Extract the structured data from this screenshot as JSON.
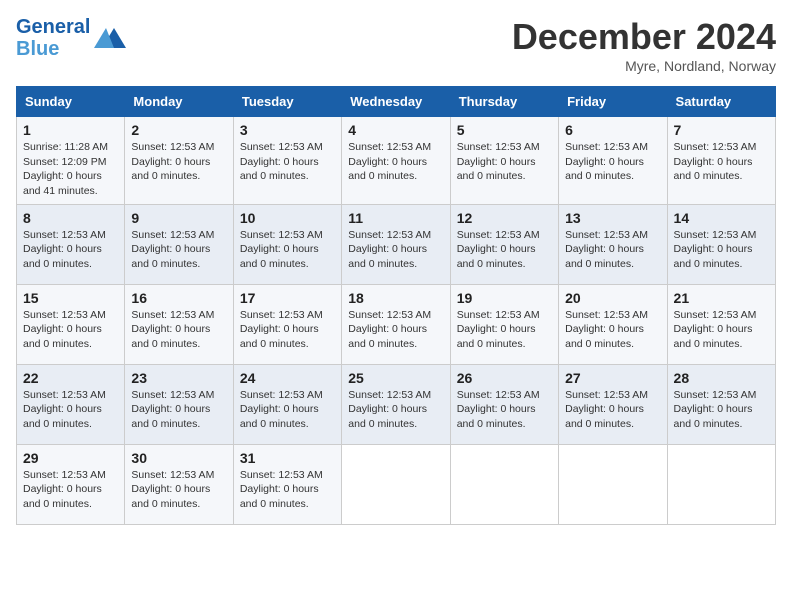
{
  "logo": {
    "line1": "General",
    "line2": "Blue"
  },
  "title": "December 2024",
  "subtitle": "Myre, Nordland, Norway",
  "days_of_week": [
    "Sunday",
    "Monday",
    "Tuesday",
    "Wednesday",
    "Thursday",
    "Friday",
    "Saturday"
  ],
  "weeks": [
    [
      {
        "num": "1",
        "info": "Sunrise: 11:28 AM\nSunset: 12:09 PM\nDaylight: 0 hours\nand 41 minutes."
      },
      {
        "num": "2",
        "info": "Sunset: 12:53 AM\nDaylight: 0 hours\nand 0 minutes."
      },
      {
        "num": "3",
        "info": "Sunset: 12:53 AM\nDaylight: 0 hours\nand 0 minutes."
      },
      {
        "num": "4",
        "info": "Sunset: 12:53 AM\nDaylight: 0 hours\nand 0 minutes."
      },
      {
        "num": "5",
        "info": "Sunset: 12:53 AM\nDaylight: 0 hours\nand 0 minutes."
      },
      {
        "num": "6",
        "info": "Sunset: 12:53 AM\nDaylight: 0 hours\nand 0 minutes."
      },
      {
        "num": "7",
        "info": "Sunset: 12:53 AM\nDaylight: 0 hours\nand 0 minutes."
      }
    ],
    [
      {
        "num": "8",
        "info": "Sunset: 12:53 AM\nDaylight: 0 hours\nand 0 minutes."
      },
      {
        "num": "9",
        "info": "Sunset: 12:53 AM\nDaylight: 0 hours\nand 0 minutes."
      },
      {
        "num": "10",
        "info": "Sunset: 12:53 AM\nDaylight: 0 hours\nand 0 minutes."
      },
      {
        "num": "11",
        "info": "Sunset: 12:53 AM\nDaylight: 0 hours\nand 0 minutes."
      },
      {
        "num": "12",
        "info": "Sunset: 12:53 AM\nDaylight: 0 hours\nand 0 minutes."
      },
      {
        "num": "13",
        "info": "Sunset: 12:53 AM\nDaylight: 0 hours\nand 0 minutes."
      },
      {
        "num": "14",
        "info": "Sunset: 12:53 AM\nDaylight: 0 hours\nand 0 minutes."
      }
    ],
    [
      {
        "num": "15",
        "info": "Sunset: 12:53 AM\nDaylight: 0 hours\nand 0 minutes."
      },
      {
        "num": "16",
        "info": "Sunset: 12:53 AM\nDaylight: 0 hours\nand 0 minutes."
      },
      {
        "num": "17",
        "info": "Sunset: 12:53 AM\nDaylight: 0 hours\nand 0 minutes."
      },
      {
        "num": "18",
        "info": "Sunset: 12:53 AM\nDaylight: 0 hours\nand 0 minutes."
      },
      {
        "num": "19",
        "info": "Sunset: 12:53 AM\nDaylight: 0 hours\nand 0 minutes."
      },
      {
        "num": "20",
        "info": "Sunset: 12:53 AM\nDaylight: 0 hours\nand 0 minutes."
      },
      {
        "num": "21",
        "info": "Sunset: 12:53 AM\nDaylight: 0 hours\nand 0 minutes."
      }
    ],
    [
      {
        "num": "22",
        "info": "Sunset: 12:53 AM\nDaylight: 0 hours\nand 0 minutes."
      },
      {
        "num": "23",
        "info": "Sunset: 12:53 AM\nDaylight: 0 hours\nand 0 minutes."
      },
      {
        "num": "24",
        "info": "Sunset: 12:53 AM\nDaylight: 0 hours\nand 0 minutes."
      },
      {
        "num": "25",
        "info": "Sunset: 12:53 AM\nDaylight: 0 hours\nand 0 minutes."
      },
      {
        "num": "26",
        "info": "Sunset: 12:53 AM\nDaylight: 0 hours\nand 0 minutes."
      },
      {
        "num": "27",
        "info": "Sunset: 12:53 AM\nDaylight: 0 hours\nand 0 minutes."
      },
      {
        "num": "28",
        "info": "Sunset: 12:53 AM\nDaylight: 0 hours\nand 0 minutes."
      }
    ],
    [
      {
        "num": "29",
        "info": "Sunset: 12:53 AM\nDaylight: 0 hours\nand 0 minutes."
      },
      {
        "num": "30",
        "info": "Sunset: 12:53 AM\nDaylight: 0 hours\nand 0 minutes."
      },
      {
        "num": "31",
        "info": "Sunset: 12:53 AM\nDaylight: 0 hours\nand 0 minutes."
      },
      null,
      null,
      null,
      null
    ]
  ]
}
